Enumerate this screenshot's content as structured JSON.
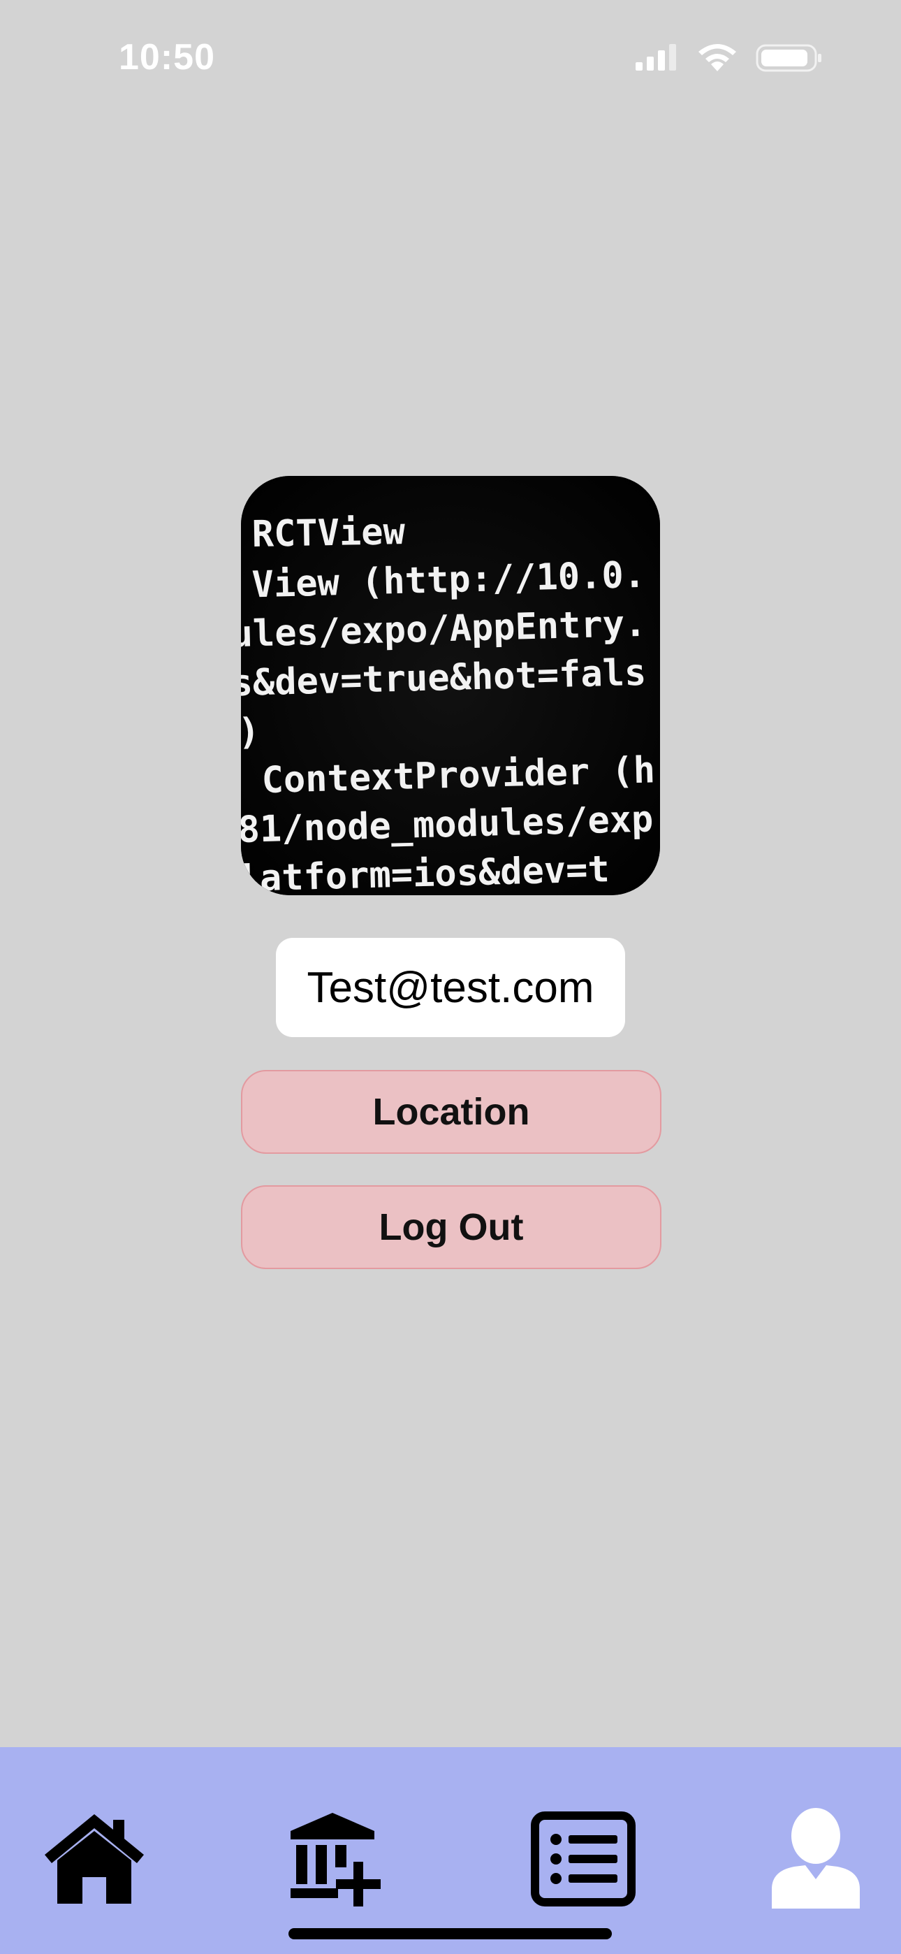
{
  "status_bar": {
    "time": "10:50",
    "icons": [
      "cellular-signal-icon",
      "wifi-icon",
      "battery-icon"
    ]
  },
  "profile": {
    "photo": {
      "description_icon": "profile-photo",
      "lines": [
        "RCTView",
        "View (http://10.0.",
        "ules/expo/AppEntry.",
        "s&dev=true&hot=fals",
        ")",
        "ContextProvider (h",
        "81/node_modules/exp",
        "latform=ios&dev=t"
      ]
    },
    "email": "Test@test.com"
  },
  "buttons": {
    "location_label": "Location",
    "logout_label": "Log Out"
  },
  "tab_bar": {
    "tabs": [
      {
        "icon": "home-icon",
        "active": false
      },
      {
        "icon": "bank-add-icon",
        "active": false
      },
      {
        "icon": "list-icon",
        "active": false
      },
      {
        "icon": "user-profile-icon",
        "active": true
      }
    ]
  },
  "colors": {
    "background": "#d3d3d3",
    "button_fill": "#ebc1c4",
    "button_border": "#e39aa0",
    "tab_bar": "#a8b1f1",
    "active_tab_icon": "#ffffff",
    "inactive_tab_icon": "#000000"
  }
}
